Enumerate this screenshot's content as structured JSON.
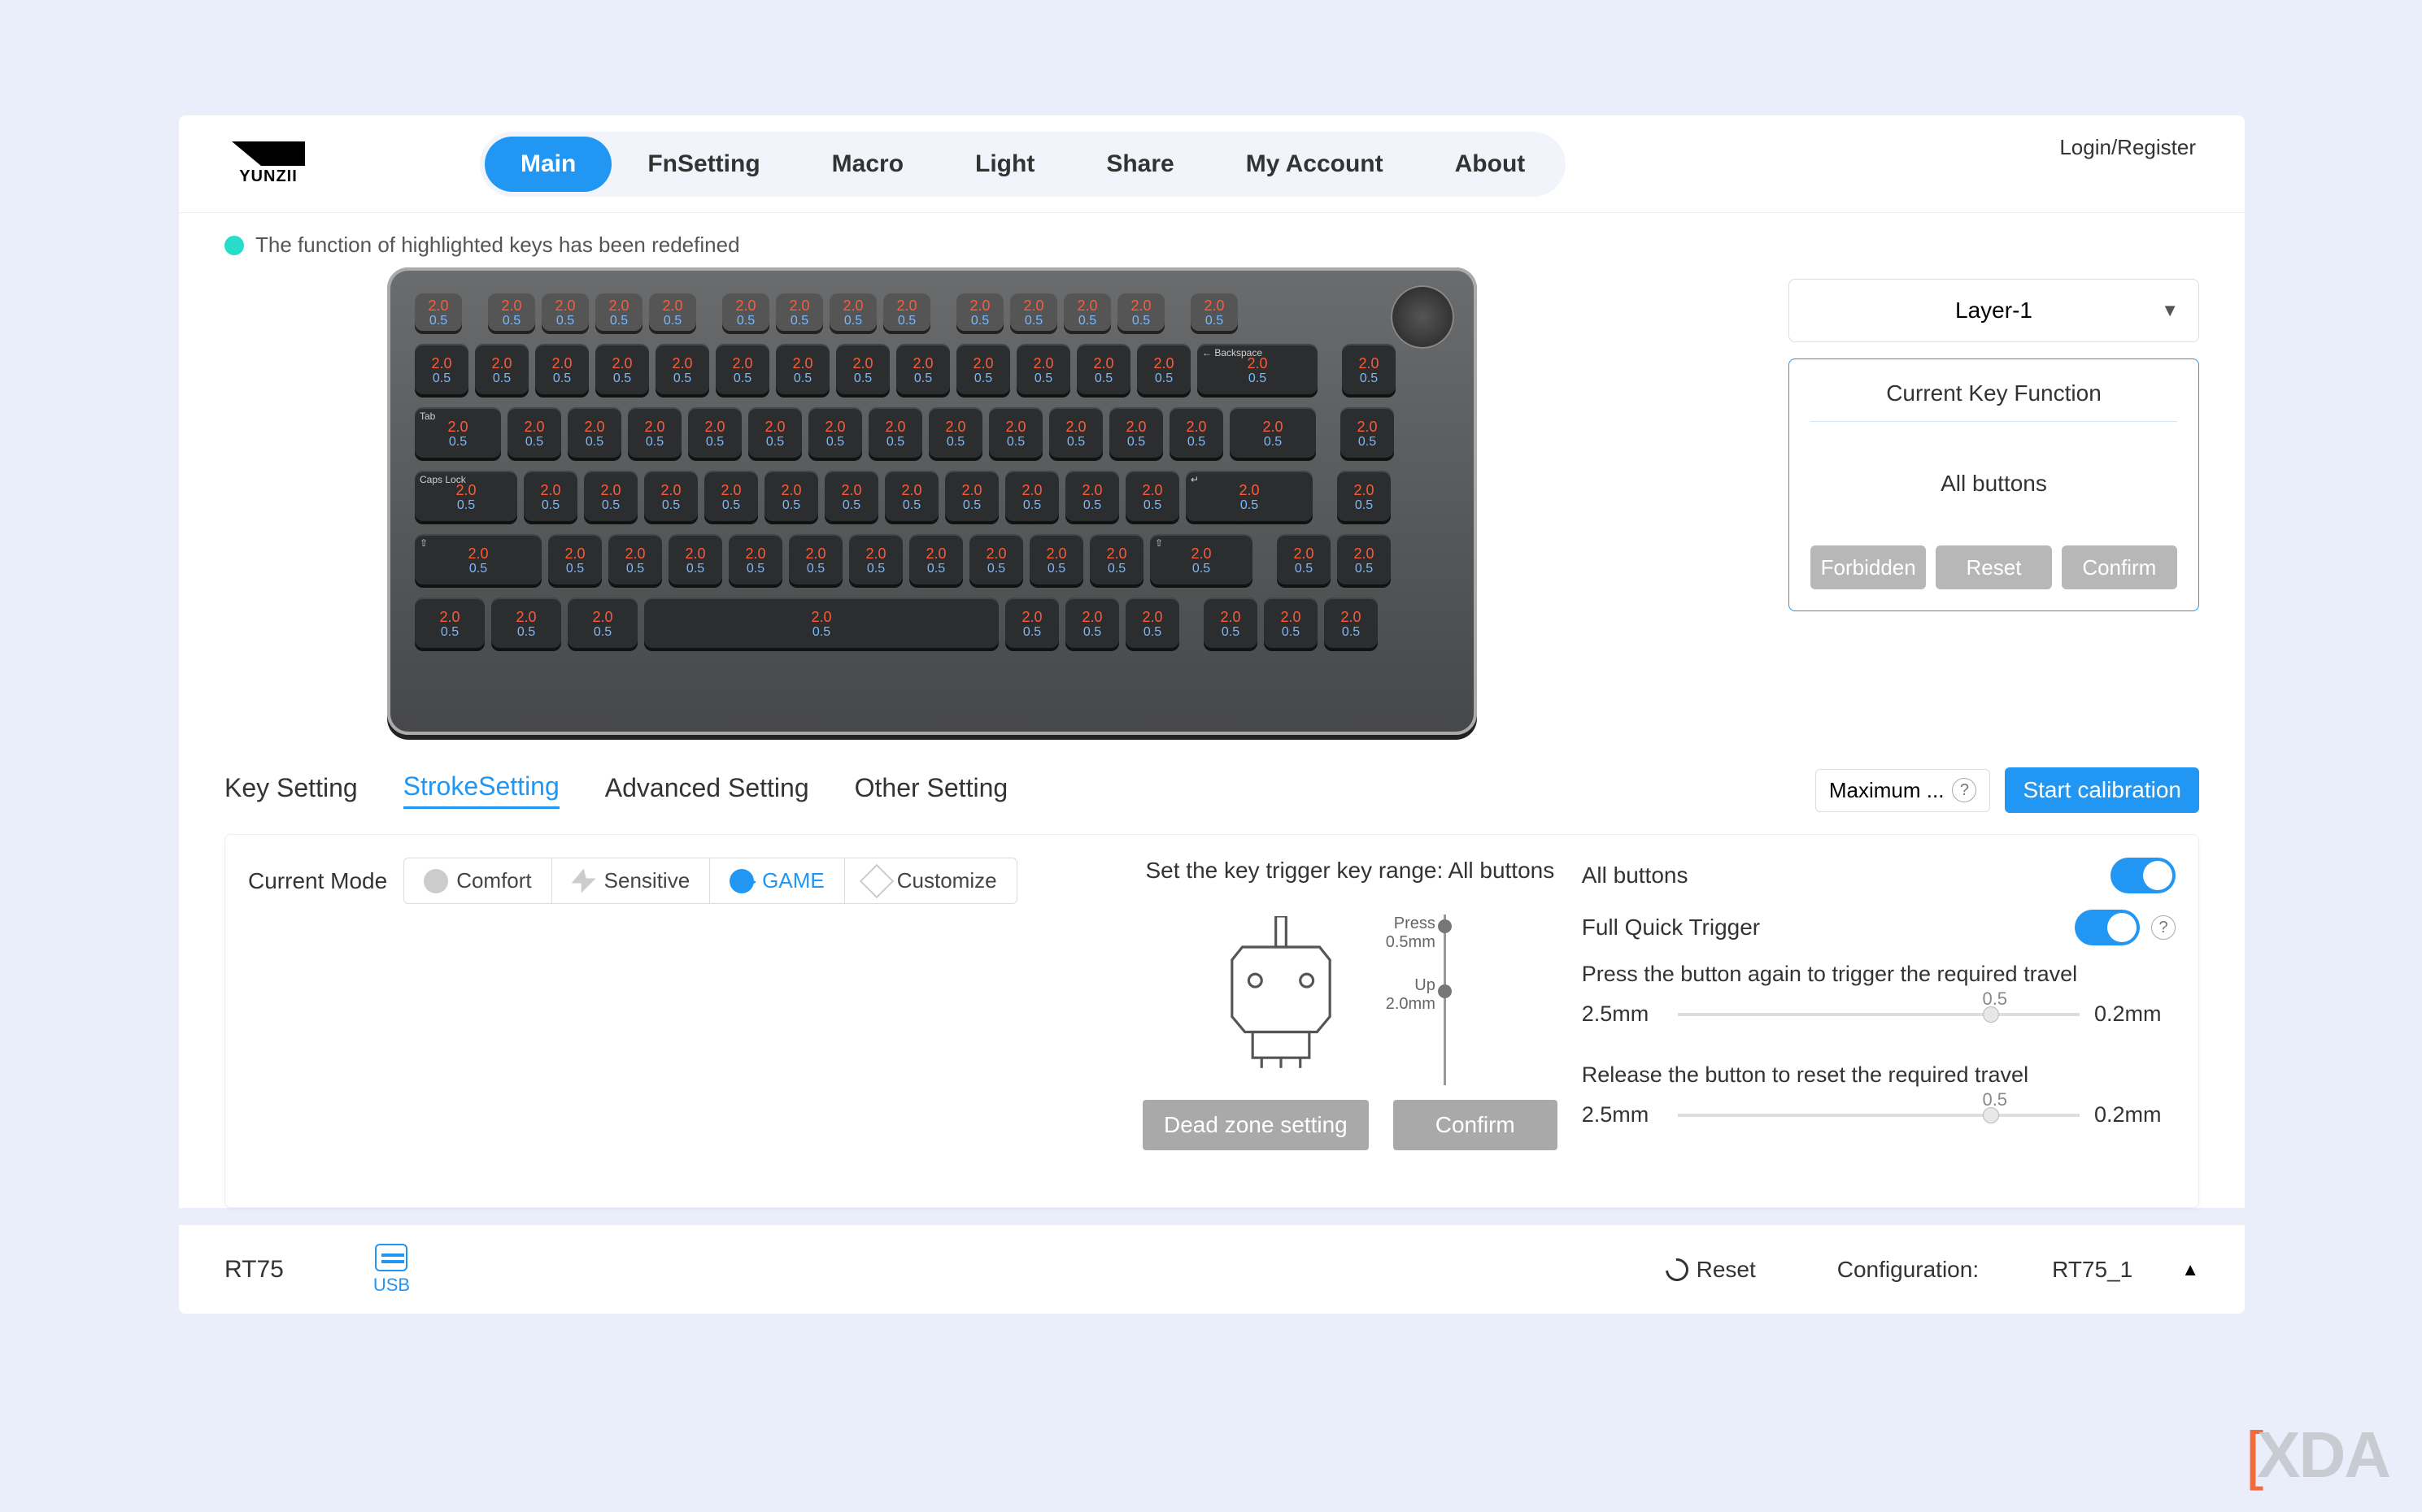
{
  "brand": "YUNZII",
  "login_text": "Login/Register",
  "nav": [
    "Main",
    "FnSetting",
    "Macro",
    "Light",
    "Share",
    "My Account",
    "About"
  ],
  "nav_active": "Main",
  "info_bar": "The function of highlighted keys has been redefined",
  "layer_select": "Layer-1",
  "ckf": {
    "title": "Current Key Function",
    "body": "All buttons",
    "btn_forbidden": "Forbidden",
    "btn_reset": "Reset",
    "btn_confirm": "Confirm"
  },
  "mid_tabs": [
    "Key Setting",
    "StrokeSetting",
    "Advanced Setting",
    "Other Setting"
  ],
  "mid_tab_active": "StrokeSetting",
  "calib_label": "Maximum ...",
  "calib_btn": "Start calibration",
  "mode_label": "Current Mode",
  "modes": [
    "Comfort",
    "Sensitive",
    "GAME",
    "Customize"
  ],
  "mode_active": "GAME",
  "trigger_title": "Set the key trigger key range: All buttons",
  "range": {
    "press_label": "Press",
    "press_val": "0.5mm",
    "up_label": "Up",
    "up_val": "2.0mm"
  },
  "dead_zone_btn": "Dead zone setting",
  "confirm_btn": "Confirm",
  "toggles": {
    "all_buttons": "All buttons",
    "full_quick": "Full Quick Trigger"
  },
  "slider1": {
    "title": "Press the button again to trigger the required travel",
    "min": "2.5mm",
    "max": "0.2mm",
    "val": "0.5"
  },
  "slider2": {
    "title": "Release the button to reset the required travel",
    "min": "2.5mm",
    "max": "0.2mm",
    "val": "0.5"
  },
  "footer": {
    "model": "RT75",
    "usb": "USB",
    "reset": "Reset",
    "config_label": "Configuration:",
    "config_value": "RT75_1"
  },
  "keycap": {
    "top": "2.0",
    "bot": "0.5"
  },
  "watermark": "XDA"
}
